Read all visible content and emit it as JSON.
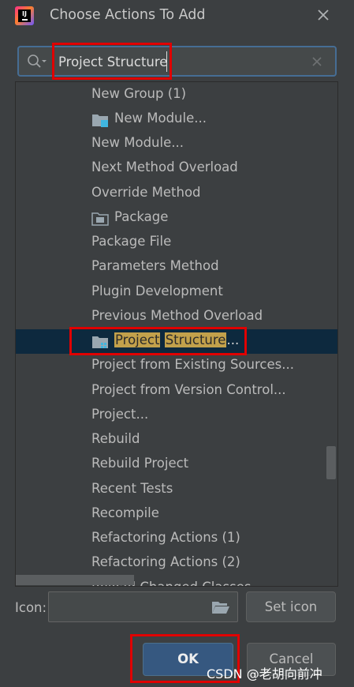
{
  "window": {
    "title": "Choose Actions To Add",
    "app_icon": "intellij-idea-icon",
    "close_icon": "close-icon"
  },
  "search": {
    "value": "Project Structure"
  },
  "list": {
    "items": [
      {
        "label": "New Group (1)",
        "icon": null
      },
      {
        "label": "New Module...",
        "icon": "module-folder-icon"
      },
      {
        "label": "New Module...",
        "icon": null
      },
      {
        "label": "Next Method Overload",
        "icon": null
      },
      {
        "label": "Override Method",
        "icon": null
      },
      {
        "label": "Package",
        "icon": "package-folder-icon"
      },
      {
        "label": "Package File",
        "icon": null
      },
      {
        "label": "Parameters Method",
        "icon": null
      },
      {
        "label": "Plugin Development",
        "icon": null
      },
      {
        "label": "Previous Method Overload",
        "icon": null
      },
      {
        "label": "Project Structure...",
        "icon": "project-structure-icon",
        "selected": true,
        "parts": [
          "Project",
          "Structure",
          "..."
        ]
      },
      {
        "label": "Project from Existing Sources...",
        "icon": null
      },
      {
        "label": "Project from Version Control...",
        "icon": null
      },
      {
        "label": "Project...",
        "icon": null
      },
      {
        "label": "Rebuild",
        "icon": null
      },
      {
        "label": "Rebuild Project",
        "icon": null
      },
      {
        "label": "Recent Tests",
        "icon": null
      },
      {
        "label": "Recompile",
        "icon": null
      },
      {
        "label": "Refactoring Actions (1)",
        "icon": null
      },
      {
        "label": "Refactoring Actions (2)",
        "icon": null
      },
      {
        "label": "Reload Changed Classes",
        "icon": null
      }
    ]
  },
  "icon_row": {
    "label": "Icon:",
    "value": "",
    "browse_icon": "folder-open-icon",
    "set_icon_label": "Set icon"
  },
  "buttons": {
    "ok_label": "OK",
    "cancel_label": "Cancel"
  },
  "watermark": "CSDN @老胡向前冲",
  "colors": {
    "background": "#3c3f41",
    "selection": "#0d293e",
    "highlight": "#c2a14b",
    "annotation_red": "#e00000",
    "ok_button": "#365880"
  }
}
